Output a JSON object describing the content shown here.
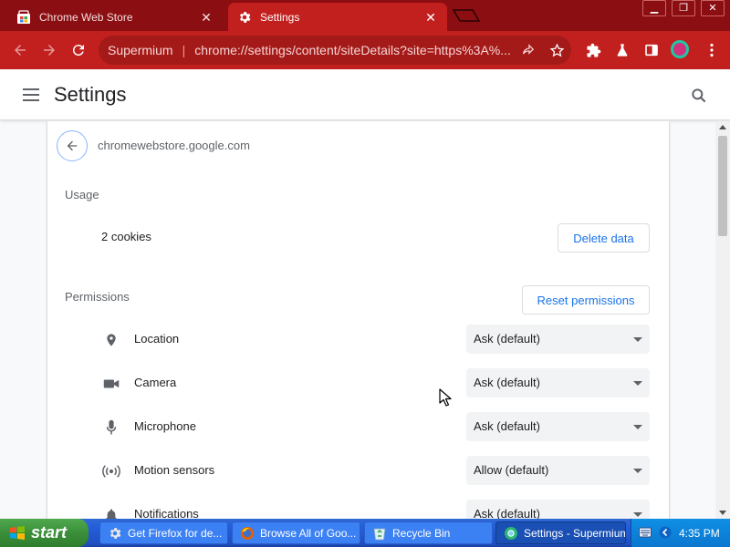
{
  "browser": {
    "tabs": [
      {
        "title": "Chrome Web Store",
        "active": false
      },
      {
        "title": "Settings",
        "active": true
      }
    ],
    "omnibox": {
      "site_label": "Supermium",
      "url": "chrome://settings/content/siteDetails?site=https%3A%..."
    },
    "colors": {
      "frame": "#8b0e12",
      "toolbar": "#c2201e"
    }
  },
  "settings": {
    "title": "Settings",
    "site": "chromewebstore.google.com",
    "usage": {
      "heading": "Usage",
      "cookies": "2 cookies",
      "delete_button": "Delete data"
    },
    "permissions": {
      "heading": "Permissions",
      "reset_button": "Reset permissions",
      "items": [
        {
          "label": "Location",
          "value": "Ask (default)",
          "icon": "location-pin-icon"
        },
        {
          "label": "Camera",
          "value": "Ask (default)",
          "icon": "camera-icon"
        },
        {
          "label": "Microphone",
          "value": "Ask (default)",
          "icon": "microphone-icon"
        },
        {
          "label": "Motion sensors",
          "value": "Allow (default)",
          "icon": "sensors-icon"
        },
        {
          "label": "Notifications",
          "value": "Ask (default)",
          "icon": "bell-icon"
        }
      ]
    }
  },
  "taskbar": {
    "start_label": "start",
    "items": [
      {
        "title": "Get Firefox for de...",
        "active": false
      },
      {
        "title": "Browse All of Goo...",
        "active": false
      },
      {
        "title": "Recycle Bin",
        "active": false
      },
      {
        "title": "Settings - Supermium",
        "active": true
      }
    ],
    "clock": "4:35 PM"
  }
}
